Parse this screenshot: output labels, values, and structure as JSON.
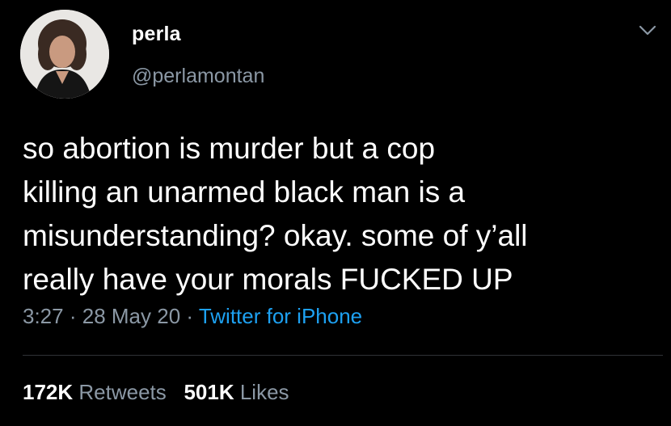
{
  "user": {
    "display_name": "perla",
    "handle": "@perlamontan"
  },
  "tweet": {
    "text": "so abortion is murder but a cop\nkilling an unarmed black man is a\nmisunderstanding? okay. some of y’all\nreally have your morals FUCKED UP",
    "time": "3:27",
    "separator": "·",
    "date": "28 May 20",
    "source": "Twitter for iPhone"
  },
  "stats": {
    "retweets_count": "172K",
    "retweets_label": "Retweets",
    "likes_count": "501K",
    "likes_label": "Likes"
  },
  "icons": {
    "chevron": "chevron-down-icon"
  },
  "colors": {
    "background": "#000000",
    "text": "#ffffff",
    "secondary": "#8b98a5",
    "link": "#1da1f2"
  }
}
